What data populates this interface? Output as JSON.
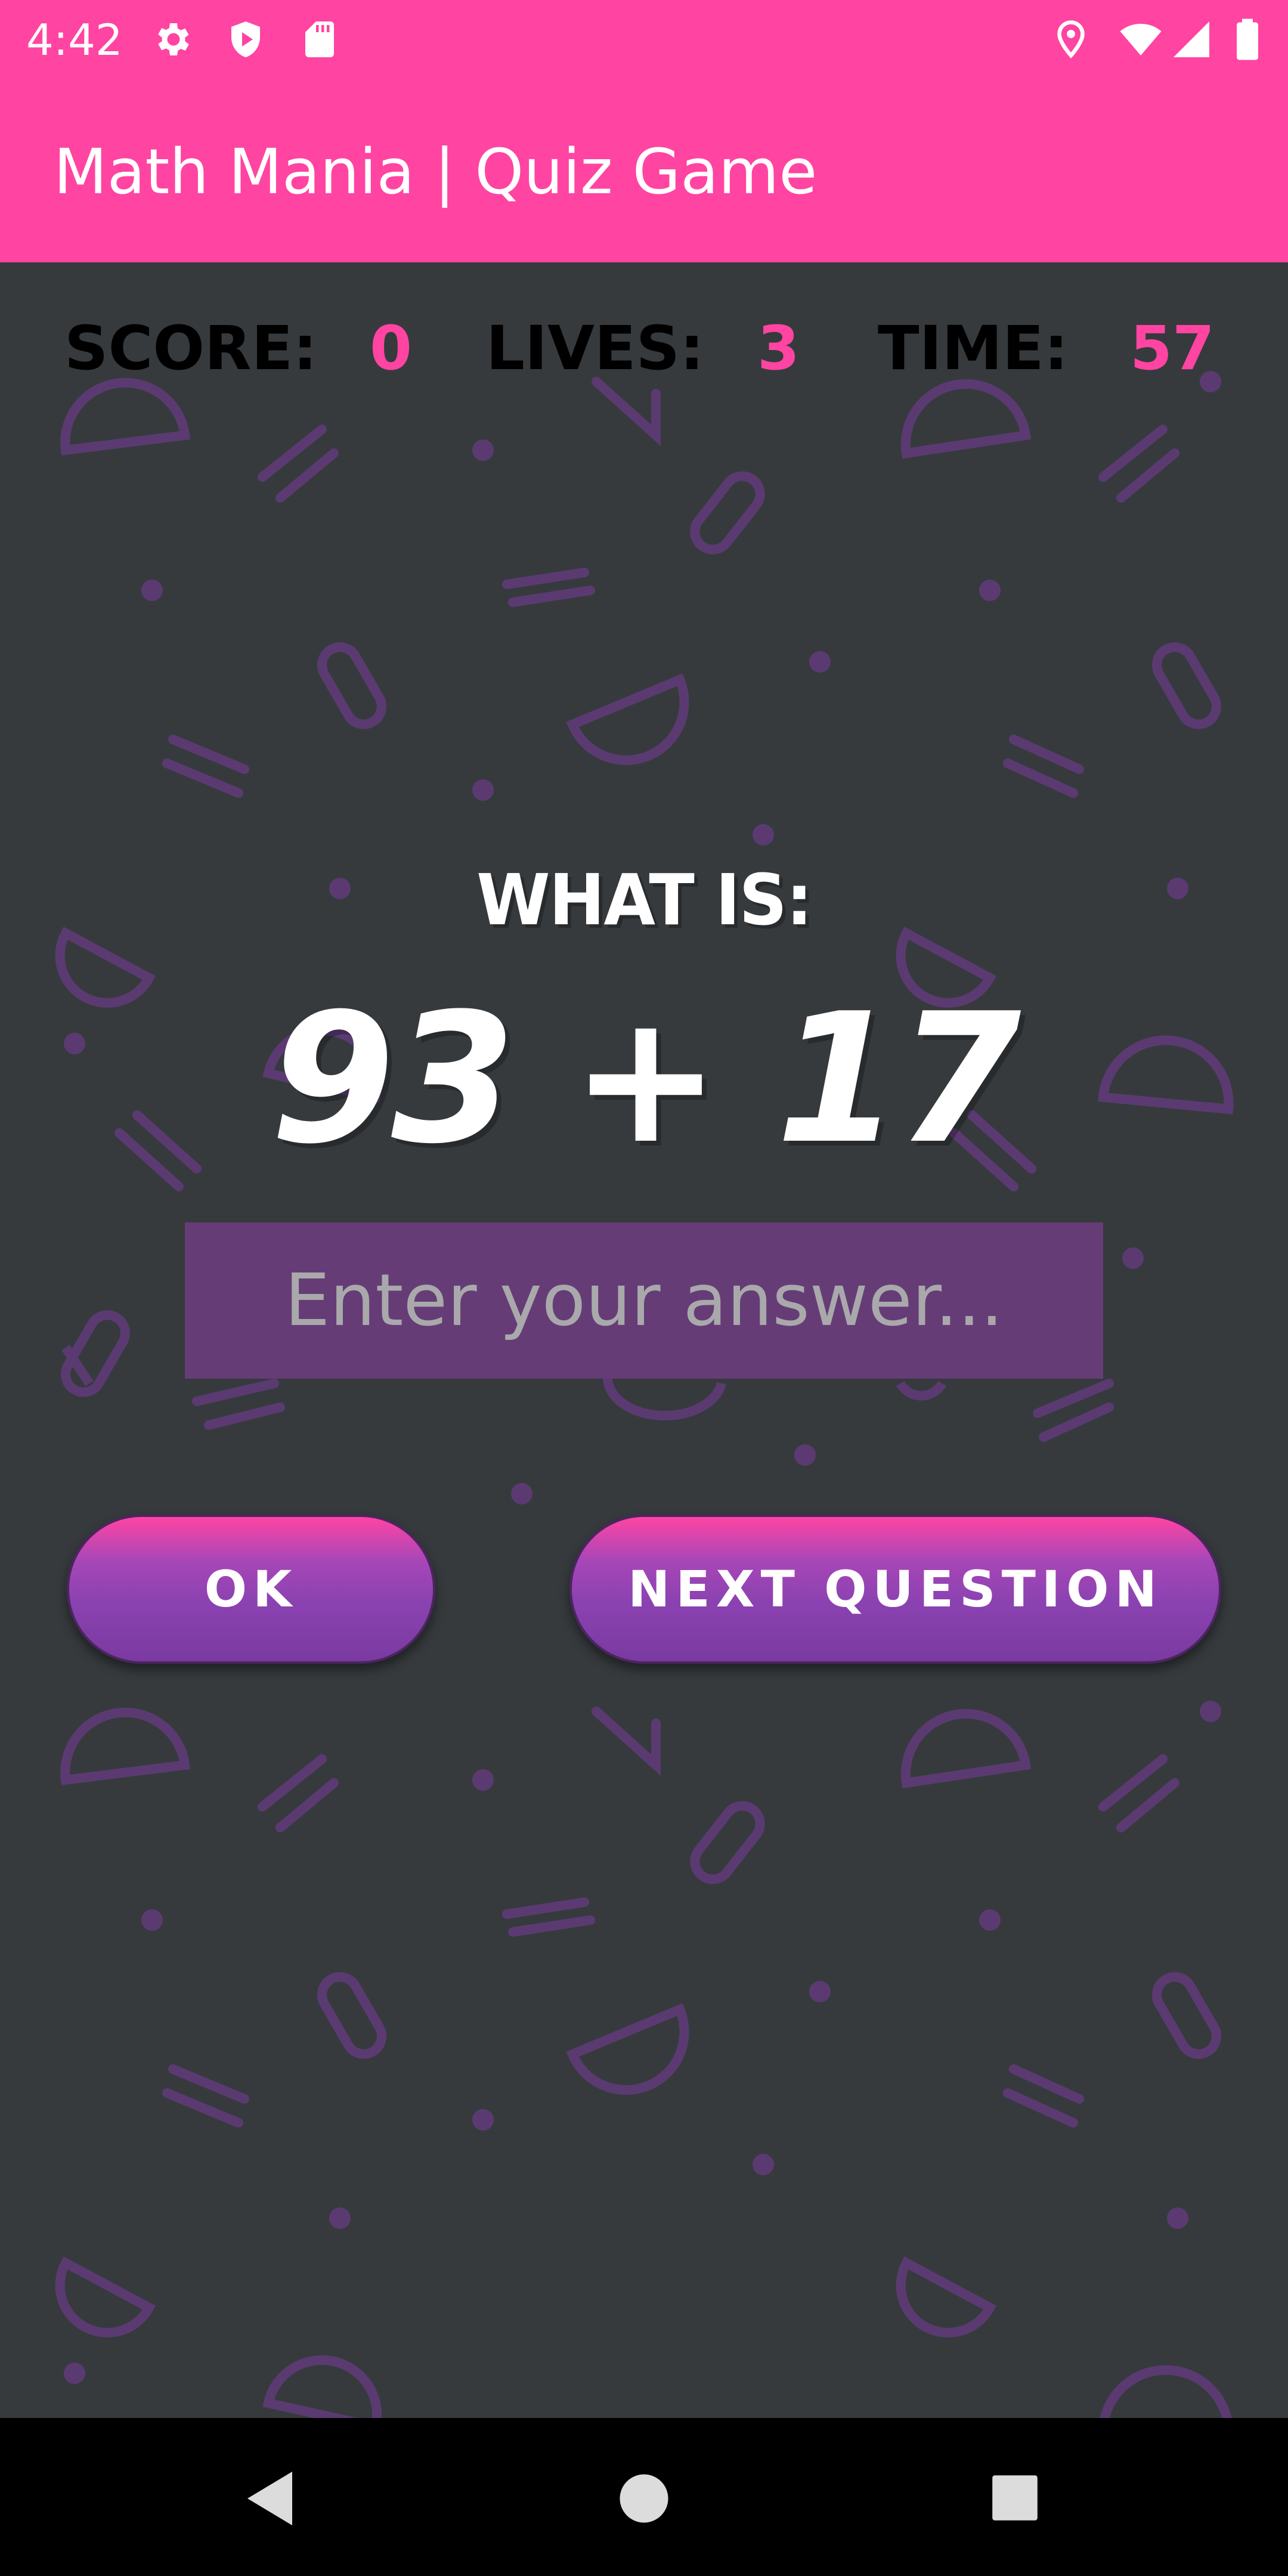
{
  "status_bar": {
    "time": "4:42",
    "icons": [
      "settings-icon",
      "shield-icon",
      "sd-card-icon",
      "location-icon",
      "wifi-icon",
      "signal-icon",
      "battery-icon"
    ]
  },
  "app_bar": {
    "title": "Math Mania | Quiz Game"
  },
  "stats": {
    "score_label": "SCORE:",
    "score_value": "0",
    "lives_label": "LIVES:",
    "lives_value": "3",
    "time_label": "TIME:",
    "time_value": "57"
  },
  "quiz": {
    "prompt": "WHAT IS:",
    "question": "93 + 17",
    "answer_value": "",
    "answer_placeholder": "Enter your answer..."
  },
  "buttons": {
    "ok_label": "OK",
    "next_label": "NEXT QUESTION"
  },
  "nav_bar": {
    "icons": [
      "back-icon",
      "home-icon",
      "recents-icon"
    ]
  },
  "colors": {
    "accent": "#ff44a2",
    "background": "#363a3d",
    "input_background": "#663c77",
    "button_purple": "#8a42b0",
    "pattern": "#5b3a72"
  }
}
